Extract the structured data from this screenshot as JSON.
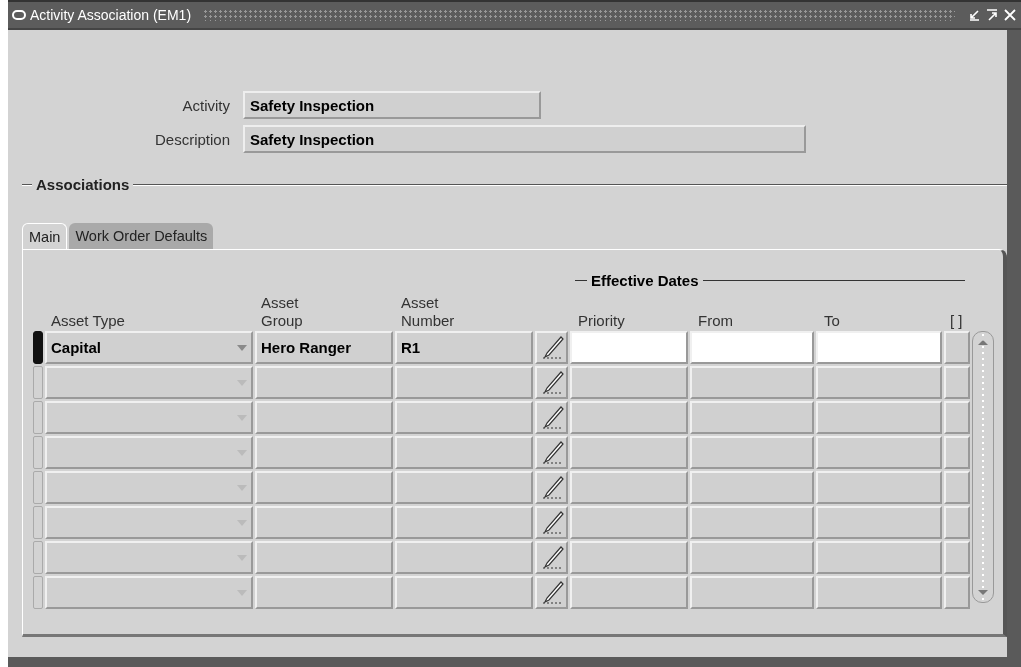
{
  "window": {
    "title": "Activity Association (EM1)"
  },
  "header": {
    "activity_label": "Activity",
    "activity": "Safety Inspection",
    "description_label": "Description",
    "description": "Safety Inspection"
  },
  "section": "Associations",
  "tabs": [
    {
      "label": "Main",
      "selected": true
    },
    {
      "label": "Work Order Defaults",
      "selected": false
    }
  ],
  "table": {
    "group_heading": "Effective Dates",
    "columns": [
      "Asset Type",
      "Asset Group",
      "Asset Number",
      "Priority",
      "From",
      "To",
      "[ ]"
    ],
    "rows": [
      {
        "current": true,
        "asset_type": "Capital",
        "asset_group": "Hero Ranger",
        "asset_number": "R1"
      },
      {
        "current": false
      },
      {
        "current": false
      },
      {
        "current": false
      },
      {
        "current": false
      },
      {
        "current": false
      },
      {
        "current": false
      },
      {
        "current": false
      }
    ]
  }
}
